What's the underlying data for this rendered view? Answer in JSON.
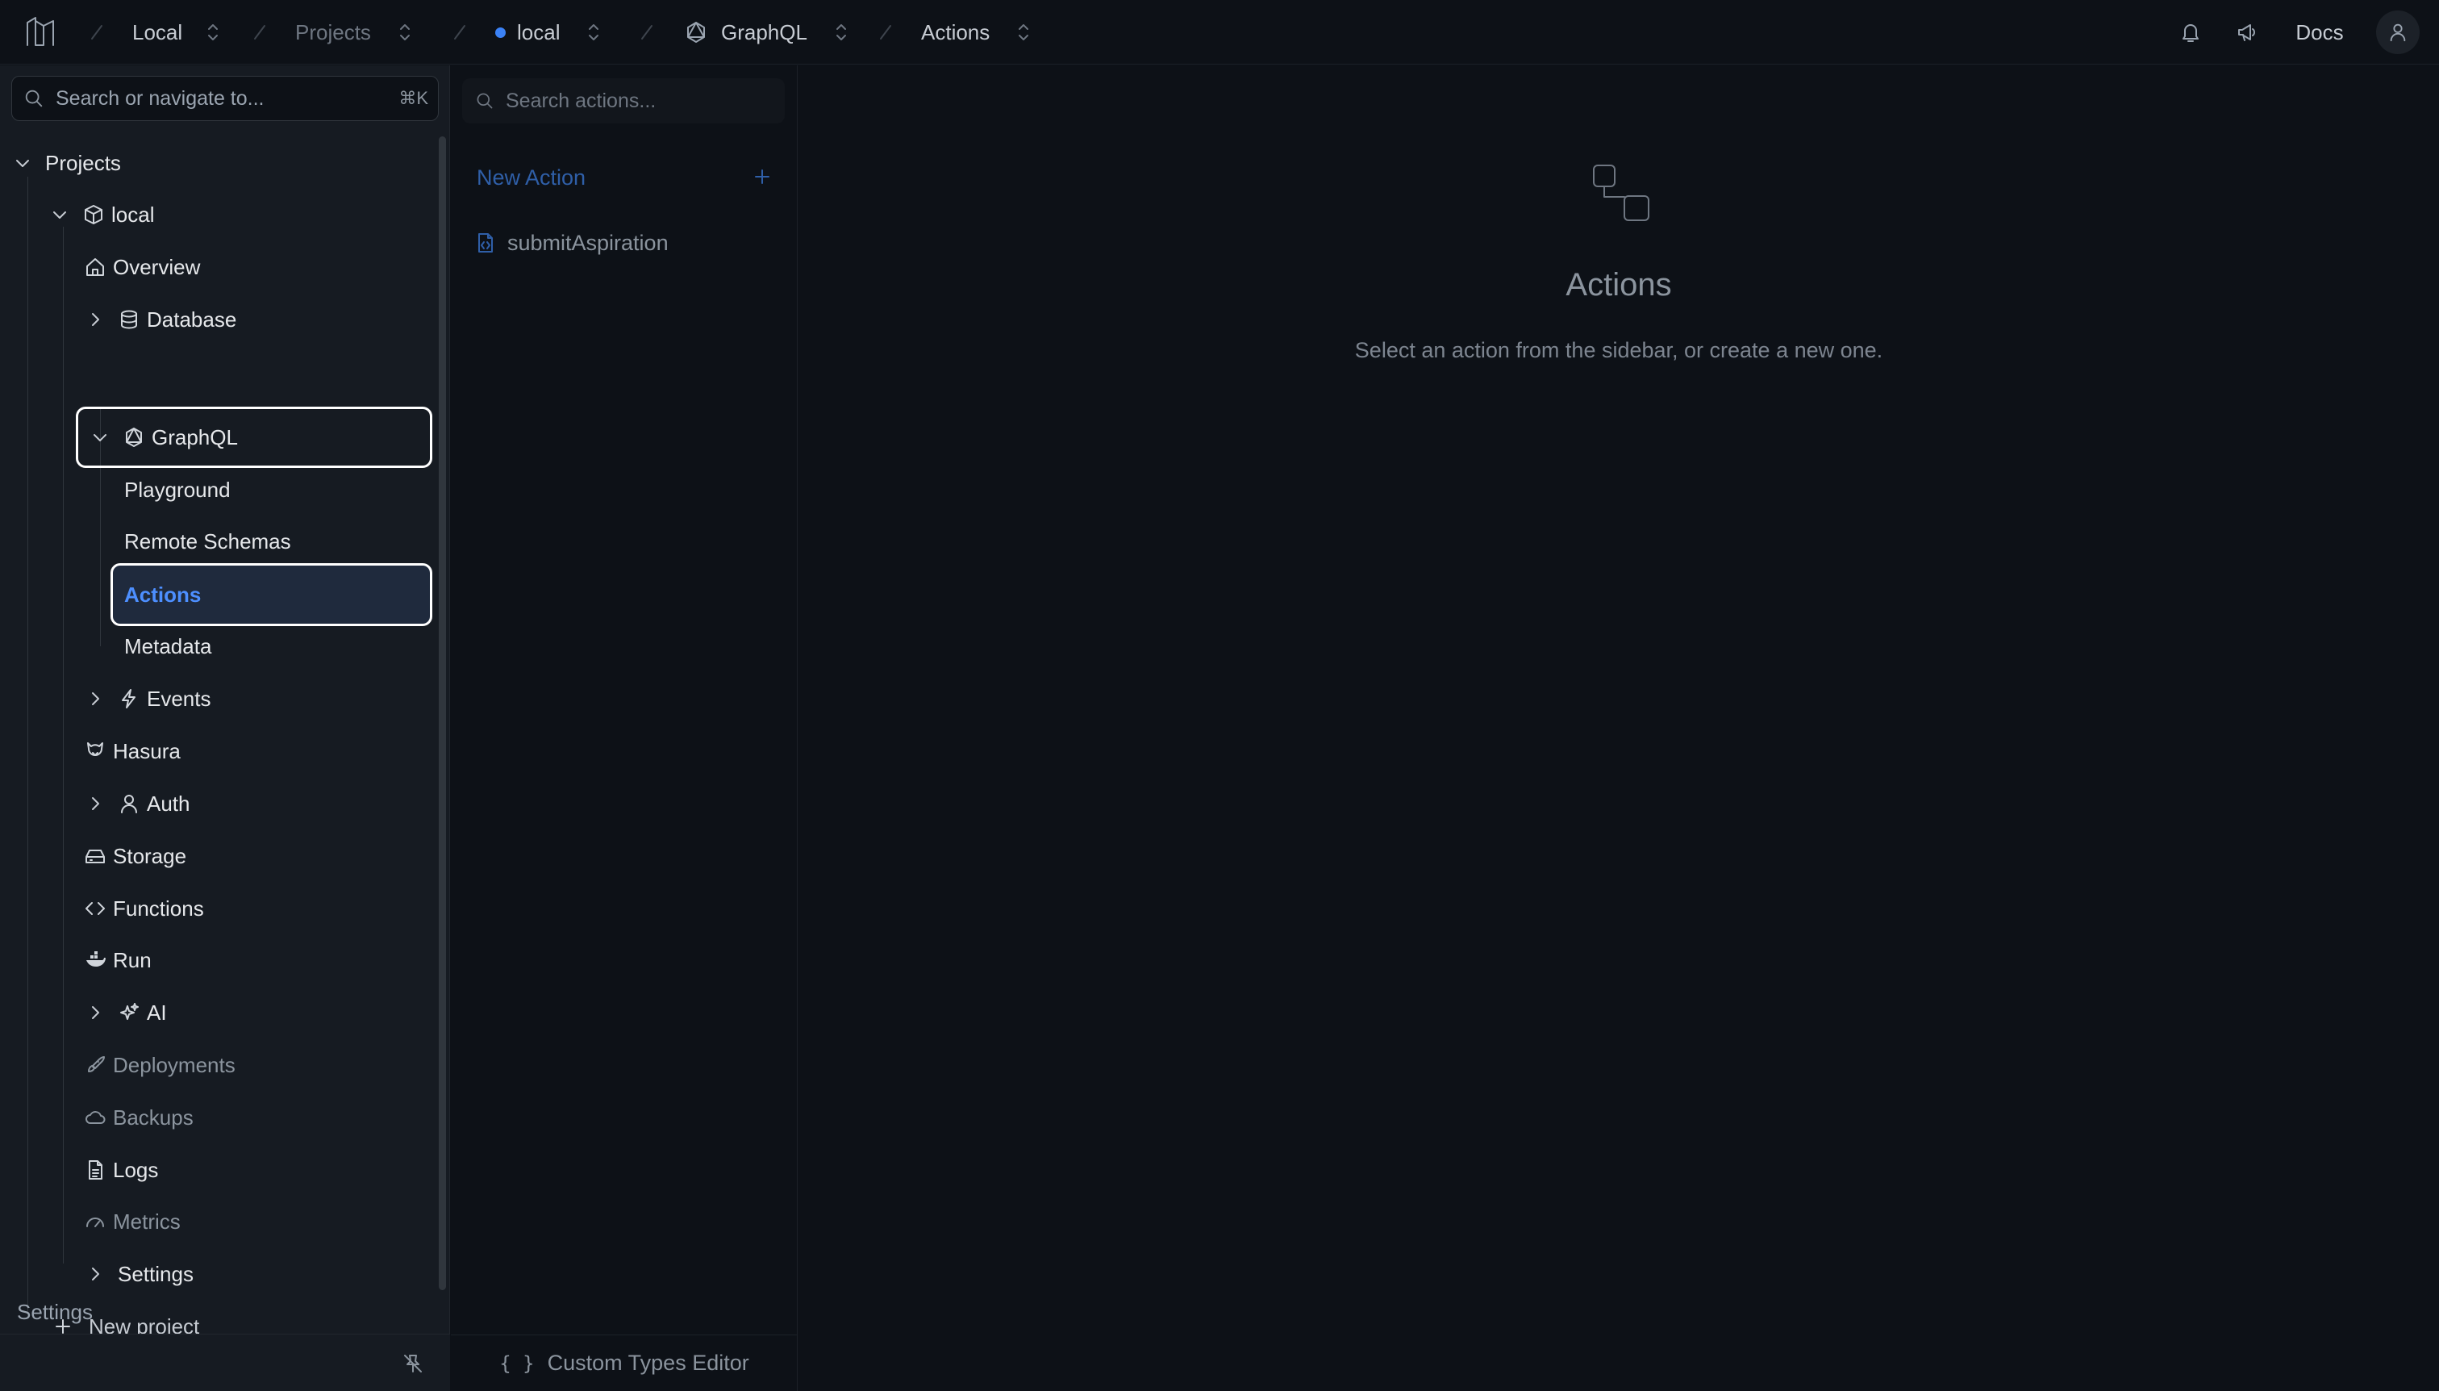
{
  "breadcrumbs": {
    "workspace": "Local",
    "projects": "Projects",
    "project": "local",
    "section": "GraphQL",
    "page": "Actions"
  },
  "topbar": {
    "docs_label": "Docs"
  },
  "sidebar": {
    "search_placeholder": "Search or navigate to...",
    "search_shortcut": "⌘K",
    "projects_label": "Projects",
    "project_name": "local",
    "items": {
      "overview": "Overview",
      "database": "Database",
      "graphql": "GraphQL",
      "playground": "Playground",
      "remote_schemas": "Remote Schemas",
      "actions": "Actions",
      "metadata": "Metadata",
      "events": "Events",
      "hasura": "Hasura",
      "auth": "Auth",
      "storage": "Storage",
      "functions": "Functions",
      "run": "Run",
      "ai": "AI",
      "deployments": "Deployments",
      "backups": "Backups",
      "logs": "Logs",
      "metrics": "Metrics",
      "settings": "Settings"
    },
    "new_project": "New project",
    "footer_settings": "Settings"
  },
  "actions_panel": {
    "search_placeholder": "Search actions...",
    "new_action": "New Action",
    "actions_list": [
      "submitAspiration"
    ],
    "custom_types_editor": "Custom Types Editor"
  },
  "main": {
    "title": "Actions",
    "subtitle": "Select an action from the sidebar, or create a new one."
  },
  "colors": {
    "accent": "#4d8fff",
    "background": "#0d1117",
    "sidebar": "#161b22"
  }
}
